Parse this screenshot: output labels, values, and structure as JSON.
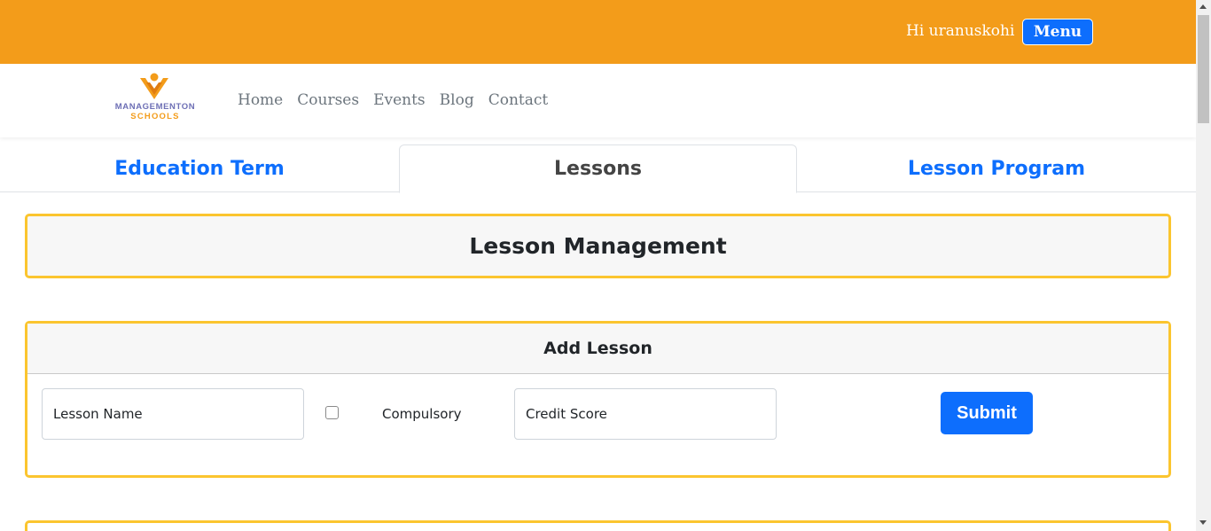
{
  "topbar": {
    "greeting": "Hi uranuskohi",
    "menu_label": "Menu",
    "background_color": "#f39c1a"
  },
  "logo": {
    "line1": "MANAGEMENTON",
    "line2": "SCHOOLS",
    "icon": "school-logo-icon"
  },
  "nav": {
    "items": [
      {
        "label": "Home"
      },
      {
        "label": "Courses"
      },
      {
        "label": "Events"
      },
      {
        "label": "Blog"
      },
      {
        "label": "Contact"
      }
    ]
  },
  "tabs": [
    {
      "label": "Education Term",
      "active": false
    },
    {
      "label": "Lessons",
      "active": true
    },
    {
      "label": "Lesson Program",
      "active": false
    }
  ],
  "management": {
    "title": "Lesson Management"
  },
  "add_lesson": {
    "title": "Add Lesson",
    "lesson_name_placeholder": "Lesson Name",
    "compulsory_label": "Compulsory",
    "compulsory_checked": false,
    "credit_score_placeholder": "Credit Score",
    "submit_label": "Submit"
  },
  "colors": {
    "accent": "#f39c1a",
    "primary": "#0d6efd",
    "panel_border": "#fbc52f"
  }
}
